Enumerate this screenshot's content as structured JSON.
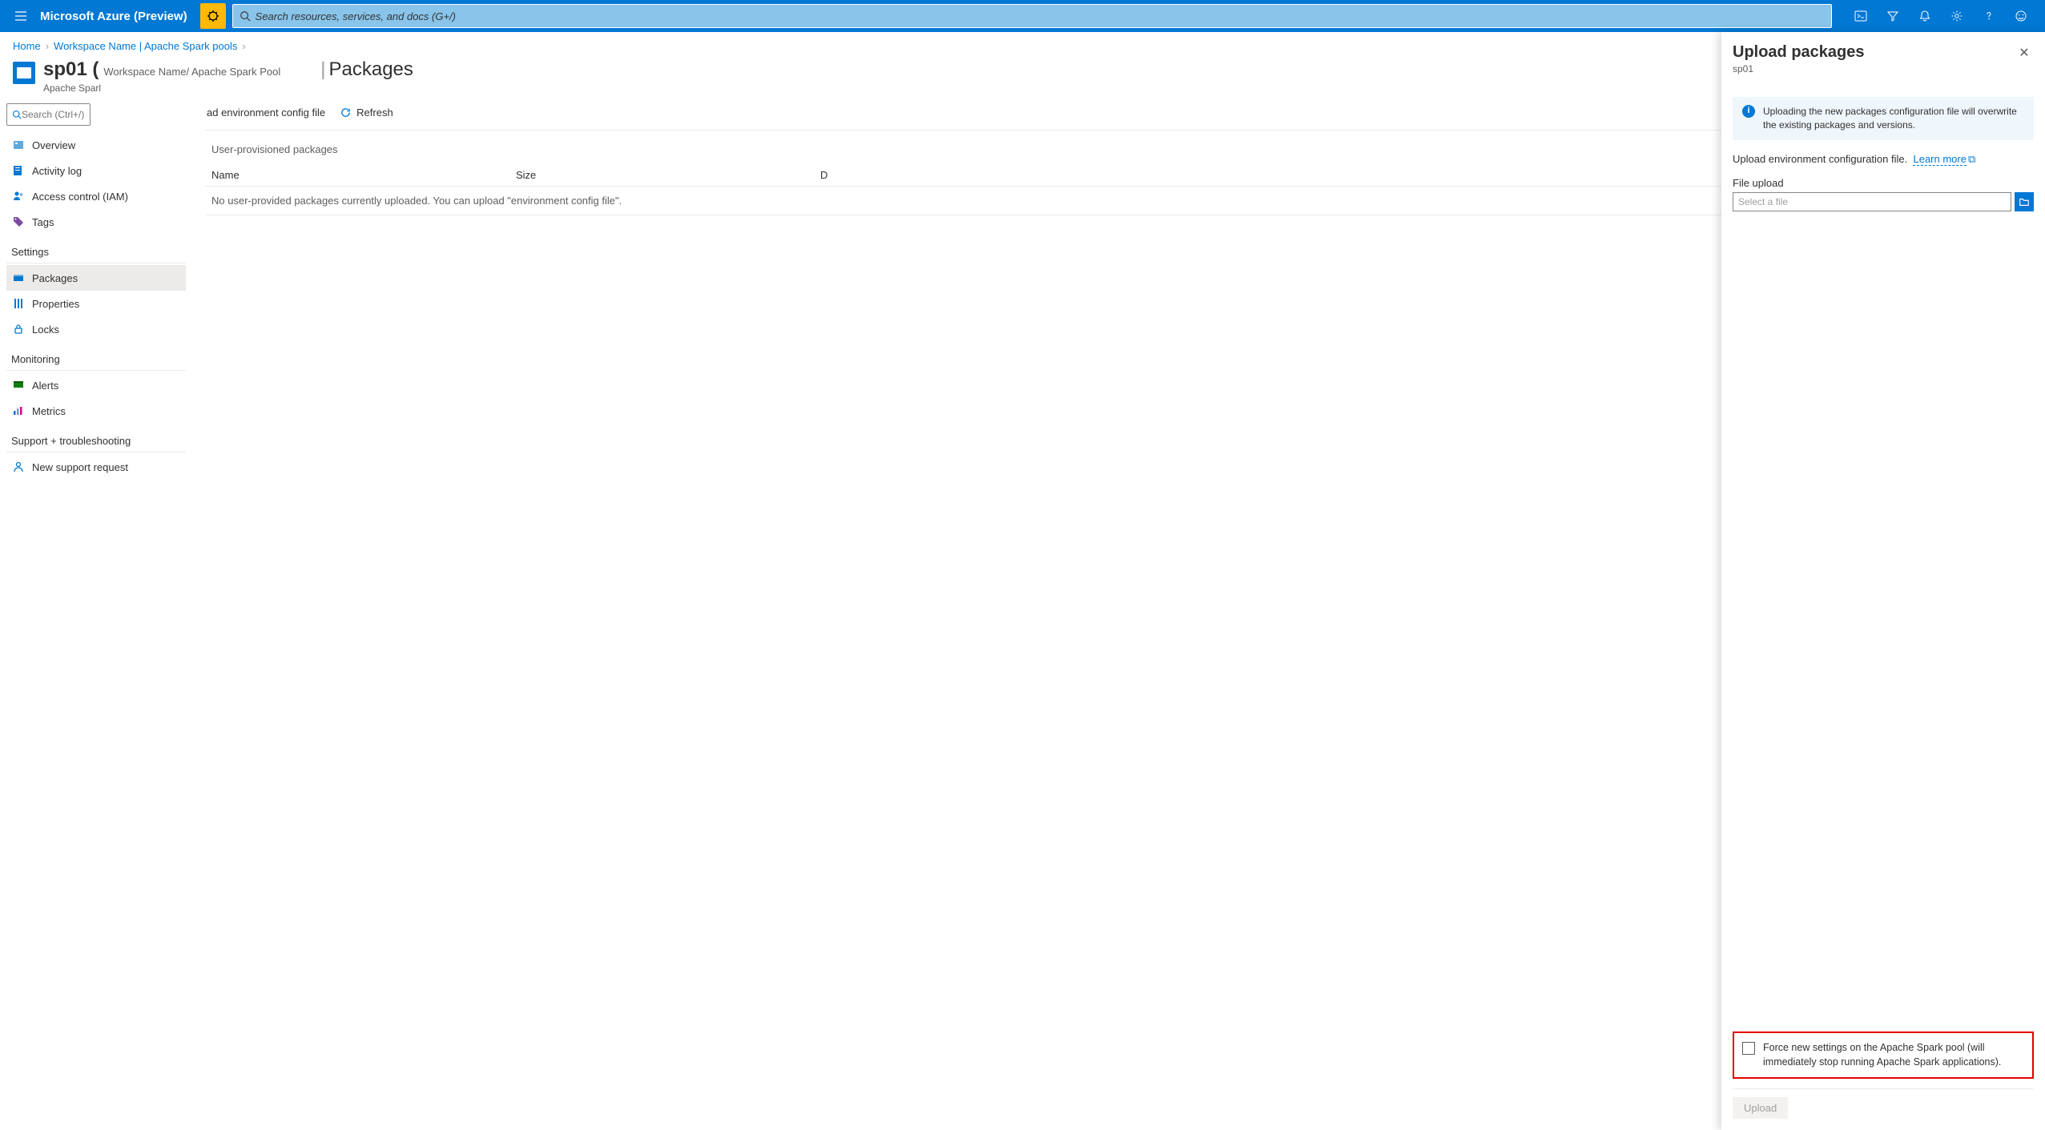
{
  "topbar": {
    "brand": "Microsoft Azure (Preview)",
    "search_placeholder": "Search resources, services, and docs (G+/)"
  },
  "breadcrumb": {
    "home": "Home",
    "workspace": "Workspace Name | Apache Spark pools"
  },
  "resource": {
    "name": "sp01 (",
    "context": "Workspace Name/ Apache Spark Pool",
    "subtype": "Apache Sparl"
  },
  "page": {
    "title": "Packages"
  },
  "sidebar": {
    "search_placeholder": "Search (Ctrl+/)",
    "items": {
      "overview": "Overview",
      "activity": "Activity log",
      "iam": "Access control (IAM)",
      "tags": "Tags"
    },
    "groups": {
      "settings": "Settings",
      "monitoring": "Monitoring",
      "support": "Support + troubleshooting"
    },
    "settings_items": {
      "packages": "Packages",
      "properties": "Properties",
      "locks": "Locks"
    },
    "monitoring_items": {
      "alerts": "Alerts",
      "metrics": "Metrics"
    },
    "support_items": {
      "newreq": "New support request"
    }
  },
  "toolbar": {
    "upload_config": "ad environment config file",
    "refresh": "Refresh"
  },
  "table": {
    "section": "User-provisioned packages",
    "col_name": "Name",
    "col_size": "Size",
    "col_date": "D",
    "empty": "No user-provided packages currently uploaded. You can upload \"environment config file\"."
  },
  "panel": {
    "title": "Upload packages",
    "sub": "sp01",
    "info": "Uploading the new packages configuration file will overwrite the existing packages and versions.",
    "desc": "Upload environment configuration file.",
    "learn_more": "Learn more",
    "file_label": "File upload",
    "file_placeholder": "Select a file",
    "force_label": "Force new settings on the Apache Spark pool (will immediately stop running Apache Spark applications).",
    "upload_btn": "Upload"
  }
}
